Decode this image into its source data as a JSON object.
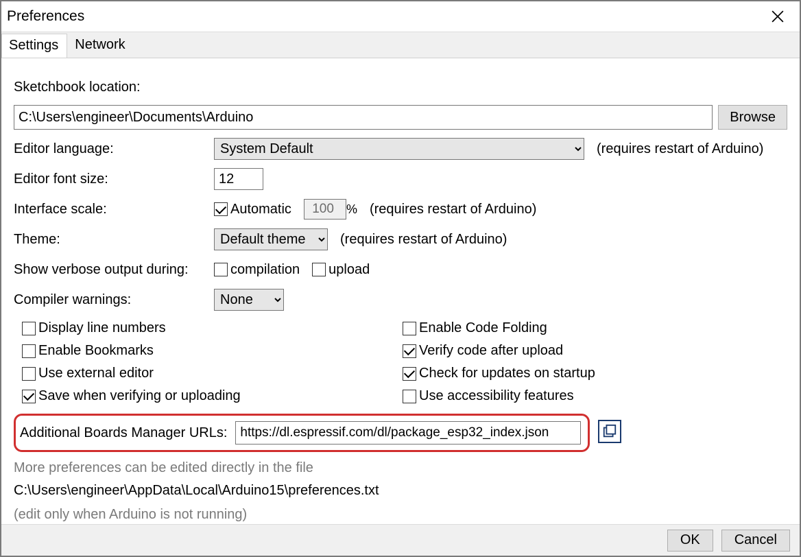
{
  "window": {
    "title": "Preferences"
  },
  "tabs": {
    "settings": "Settings",
    "network": "Network"
  },
  "sketchbook": {
    "label": "Sketchbook location:",
    "value": "C:\\Users\\engineer\\Documents\\Arduino",
    "browse": "Browse"
  },
  "language": {
    "label": "Editor language:",
    "value": "System Default",
    "hint": "(requires restart of Arduino)"
  },
  "fontsize": {
    "label": "Editor font size:",
    "value": "12"
  },
  "scale": {
    "label": "Interface scale:",
    "auto_label": "Automatic",
    "auto_checked": true,
    "value": "100",
    "percent": "%",
    "hint": "(requires restart of Arduino)"
  },
  "theme": {
    "label": "Theme:",
    "value": "Default theme",
    "hint": "(requires restart of Arduino)"
  },
  "verbose": {
    "label": "Show verbose output during:",
    "compilation_label": "compilation",
    "compilation_checked": false,
    "upload_label": "upload",
    "upload_checked": false
  },
  "warnings": {
    "label": "Compiler warnings:",
    "value": "None"
  },
  "options": {
    "display_line_numbers": {
      "label": "Display line numbers",
      "checked": false
    },
    "enable_bookmarks": {
      "label": "Enable Bookmarks",
      "checked": false
    },
    "use_external_editor": {
      "label": "Use external editor",
      "checked": false
    },
    "save_when_verifying": {
      "label": "Save when verifying or uploading",
      "checked": true
    },
    "enable_code_folding": {
      "label": "Enable Code Folding",
      "checked": false
    },
    "verify_after_upload": {
      "label": "Verify code after upload",
      "checked": true
    },
    "check_updates": {
      "label": "Check for updates on startup",
      "checked": true
    },
    "accessibility": {
      "label": "Use accessibility features",
      "checked": false
    }
  },
  "boards": {
    "label": "Additional Boards Manager URLs:",
    "value": "https://dl.espressif.com/dl/package_esp32_index.json"
  },
  "more": {
    "line1": "More preferences can be edited directly in the file",
    "path": "C:\\Users\\engineer\\AppData\\Local\\Arduino15\\preferences.txt",
    "line2": "(edit only when Arduino is not running)"
  },
  "footer": {
    "ok": "OK",
    "cancel": "Cancel"
  }
}
